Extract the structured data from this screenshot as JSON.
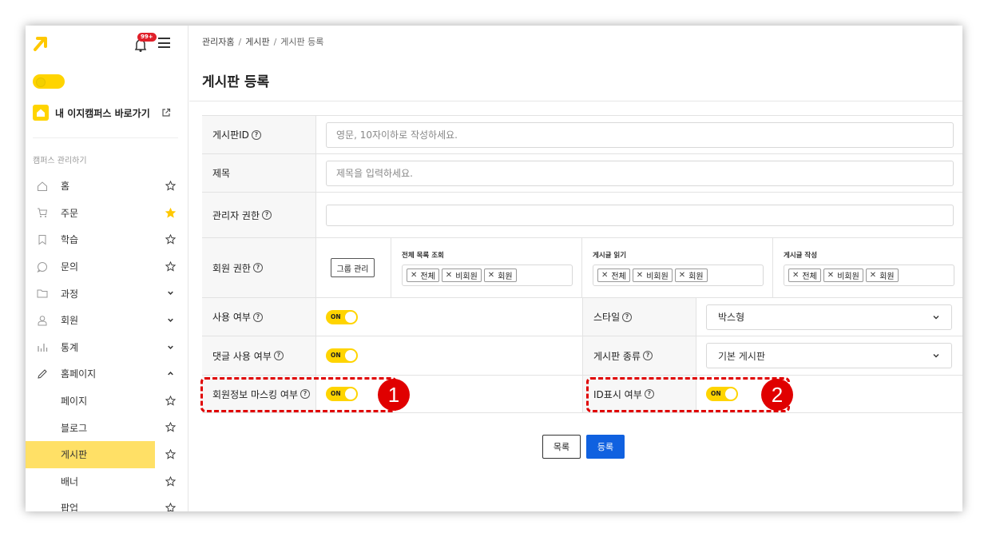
{
  "sidebar": {
    "notification_badge": "99+",
    "campus_link_label": "내 이지캠퍼스 바로가기",
    "section_label": "캠퍼스 관리하기",
    "items": [
      {
        "label": "홈"
      },
      {
        "label": "주문"
      },
      {
        "label": "학습"
      },
      {
        "label": "문의"
      },
      {
        "label": "과정"
      },
      {
        "label": "회원"
      },
      {
        "label": "통계"
      },
      {
        "label": "홈페이지"
      },
      {
        "label": "페이지"
      },
      {
        "label": "블로그"
      },
      {
        "label": "게시판"
      },
      {
        "label": "배너"
      },
      {
        "label": "팝업"
      }
    ]
  },
  "breadcrumb": {
    "root": "관리자홈",
    "sep": "/",
    "section": "게시판",
    "current": "게시판 등록"
  },
  "page_title": "게시판 등록",
  "form": {
    "help_glyph": "?",
    "board_id": {
      "label": "게시판ID",
      "placeholder": "영문, 10자이하로 작성하세요."
    },
    "title": {
      "label": "제목",
      "placeholder": "제목을 입력하세요."
    },
    "admin_perm": {
      "label": "관리자 권한",
      "value": ""
    },
    "member_perm": {
      "label": "회원 권한",
      "group_button": "그룹 관리",
      "columns": [
        {
          "title": "전체 목록 조회",
          "tags": [
            "전체",
            "비회원",
            "회원"
          ]
        },
        {
          "title": "게시글 읽기",
          "tags": [
            "전체",
            "비회원",
            "회원"
          ]
        },
        {
          "title": "게시글 작성",
          "tags": [
            "전체",
            "비회원",
            "회원"
          ]
        }
      ]
    },
    "use": {
      "label": "사용 여부",
      "toggle": "ON"
    },
    "style": {
      "label": "스타일",
      "value": "박스형"
    },
    "comment_use": {
      "label": "댓글 사용 여부",
      "toggle": "ON"
    },
    "board_type": {
      "label": "게시판 종류",
      "value": "기본 게시판"
    },
    "masking": {
      "label": "회원정보 마스킹 여부",
      "toggle": "ON"
    },
    "id_display": {
      "label": "ID표시 여부",
      "toggle": "ON"
    }
  },
  "annotations": {
    "one": "1",
    "two": "2",
    "color": "#e00000"
  },
  "buttons": {
    "list": "목록",
    "submit": "등록"
  },
  "colors": {
    "accent": "#ffd400",
    "primary": "#1061e0",
    "active_menu": "#ffe066"
  }
}
